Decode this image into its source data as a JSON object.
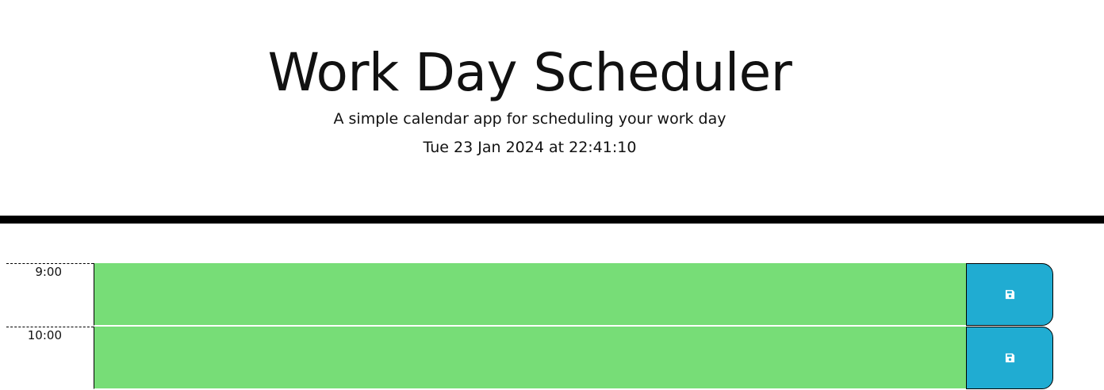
{
  "header": {
    "title": "Work Day Scheduler",
    "lead": "A simple calendar app for scheduling your work day",
    "current_day": "Tue 23 Jan 2024 at 22:41:10"
  },
  "colors": {
    "past_future_block": "#77dd77",
    "save_button": "#20acd2",
    "divider": "#000000"
  },
  "time_blocks": [
    {
      "hour": "9:00",
      "description": "",
      "save_icon": "save-icon"
    },
    {
      "hour": "10:00",
      "description": "",
      "save_icon": "save-icon"
    }
  ]
}
